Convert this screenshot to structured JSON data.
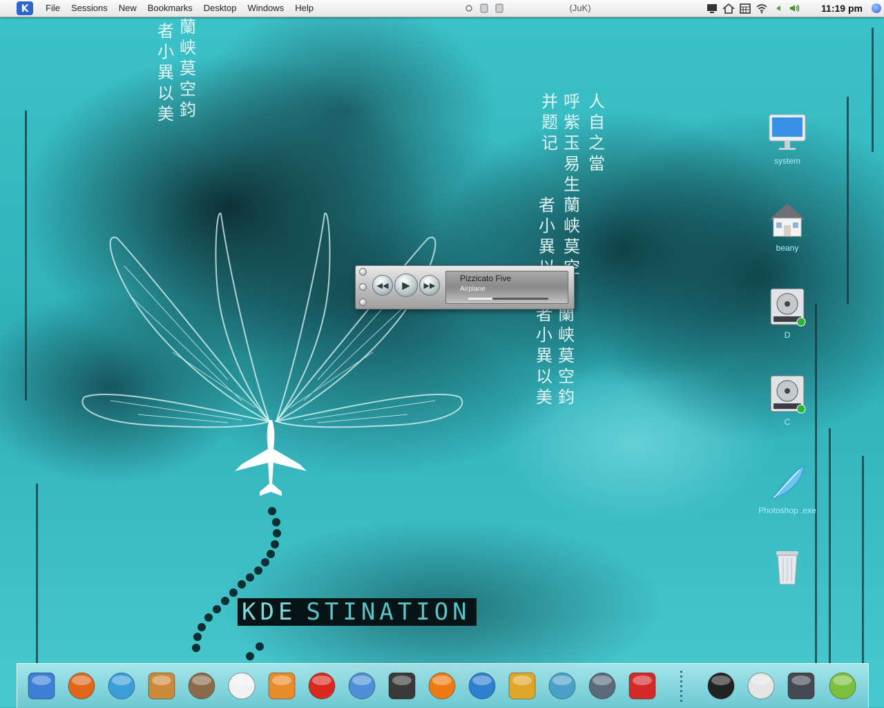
{
  "top_panel": {
    "menu": [
      "File",
      "Sessions",
      "New",
      "Bookmarks",
      "Desktop",
      "Windows",
      "Help"
    ],
    "window_title": "(JuK)",
    "clock": "11:19 pm",
    "kmenu_icon": "kde-gear-icon",
    "tray_icons": [
      "monitor-icon",
      "home-icon",
      "calendar-icon",
      "wifi-icon",
      "speaker-arrow-icon",
      "volume-icon"
    ]
  },
  "juk_player": {
    "artist": "Pizzicato Five",
    "track": "Airplane",
    "progress": 0.3,
    "buttons": [
      "rewind",
      "play",
      "fast-forward"
    ]
  },
  "desktop_icons": [
    {
      "label": "system",
      "icon": "computer-icon"
    },
    {
      "label": "beany",
      "icon": "home-folder-icon"
    },
    {
      "label": "D",
      "icon": "hard-drive-icon"
    },
    {
      "label": "C",
      "icon": "hard-drive-icon"
    },
    {
      "label": "Photoshop .exe",
      "icon": "feather-icon"
    },
    {
      "label": "",
      "icon": "trash-icon"
    }
  ],
  "wallpaper": {
    "logo_part1": "KDE",
    "logo_part2": "STINATION"
  },
  "dock": {
    "items": [
      "finder-face-icon",
      "firefox-icon",
      "messenger-icon",
      "emule-donkey-icon",
      "photo-stamp-icon",
      "notepad-icon",
      "gimp-icon",
      "burner-flame-icon",
      "lightning-disc-icon",
      "clapperboard-icon",
      "vlc-cone-icon",
      "media-player-icon",
      "mp3-player-icon",
      "ipod-icon",
      "headset-icon",
      "camera-icon",
      "tux-penguin-icon",
      "cd-document-icon",
      "speedometer-icon",
      "photo-frame-icon"
    ]
  },
  "colors": {
    "accent": "#2fb3bb",
    "dark_ink": "#0c3a40",
    "label": "#aeefff"
  }
}
